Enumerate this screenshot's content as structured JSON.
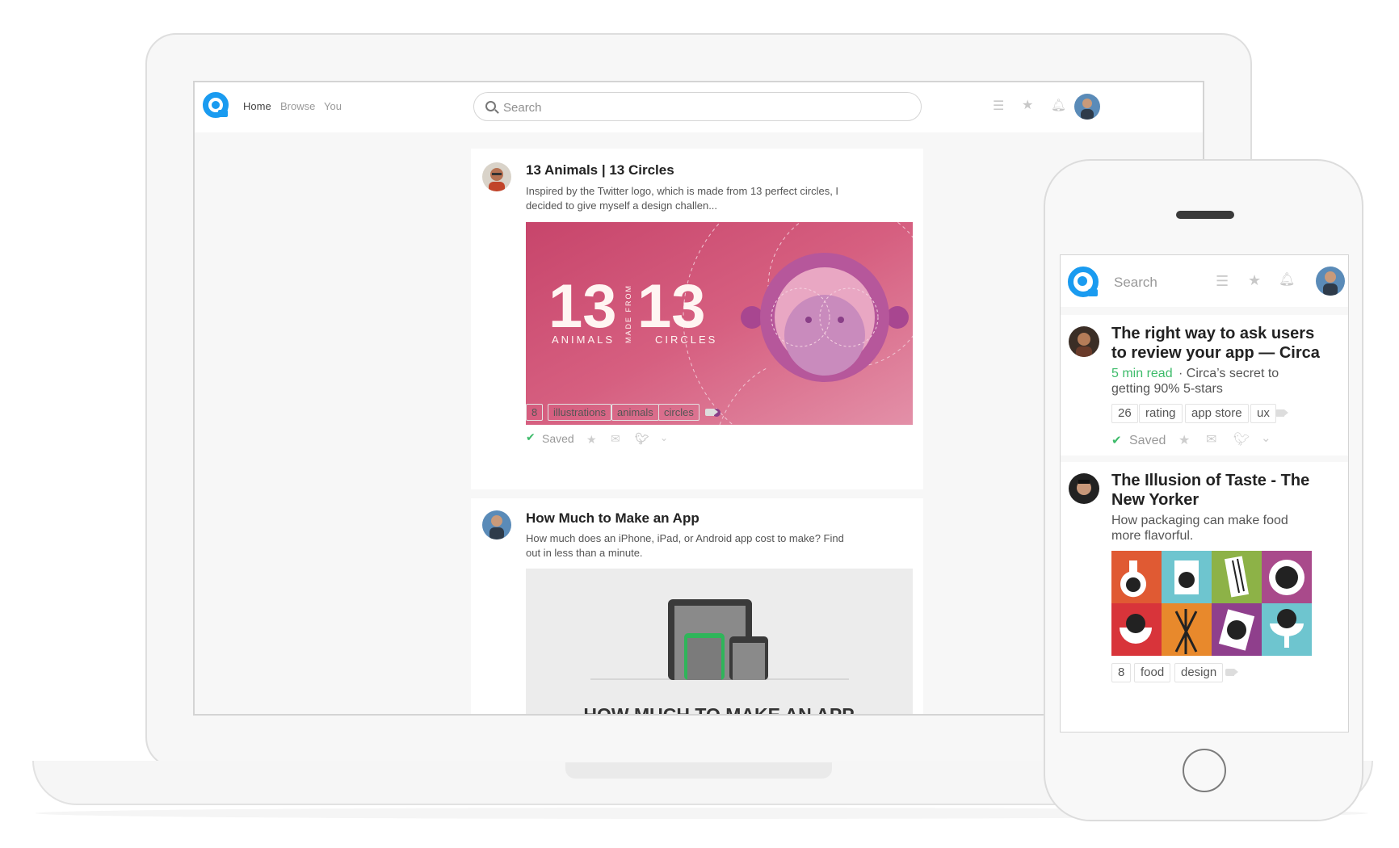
{
  "desktop": {
    "nav": {
      "home": "Home",
      "browse": "Browse",
      "you": "You"
    },
    "search": {
      "placeholder": "Search"
    },
    "articles": [
      {
        "title": "13 Animals | 13 Circles",
        "excerpt_line1": "Inspired by the Twitter logo, which is made from 13 perfect circles, I",
        "excerpt_line2": "decided to give myself a design challen...",
        "image": {
          "num_left": "13",
          "num_right": "13",
          "label_left": "ANIMALS",
          "label_mid": "MADE FROM",
          "label_right": "CIRCLES"
        },
        "count": "8",
        "tags": [
          "illustrations",
          "animals",
          "circles"
        ],
        "saved_label": "Saved"
      },
      {
        "title": "How Much to Make an App",
        "excerpt_line1": "How much does an iPhone, iPad, or Android app cost to make? Find",
        "excerpt_line2": "out in less than a minute.",
        "image": {
          "heading": "HOW MUCH TO MAKE AN APP"
        }
      }
    ]
  },
  "mobile": {
    "search": {
      "placeholder": "Search"
    },
    "articles": [
      {
        "title_line1": "The right way to ask users",
        "title_line2": "to review your app — Circa",
        "read_time": "5 min read",
        "excerpt_line1": " · Circa’s secret to",
        "excerpt_line2": "getting 90% 5-stars",
        "count": "26",
        "tags": [
          "rating",
          "app store",
          "ux"
        ],
        "saved_label": "Saved"
      },
      {
        "title_line1": "The Illusion of Taste - The",
        "title_line2": "New Yorker",
        "excerpt_line1": "How packaging can make food",
        "excerpt_line2": "more flavorful.",
        "count": "8",
        "tags": [
          "food",
          "design"
        ]
      }
    ]
  },
  "colors": {
    "brand": "#1a9bf0",
    "saved": "#3dbb6a",
    "read_time": "#3dbb6a"
  },
  "icons": [
    "search-icon",
    "list-icon",
    "star-icon",
    "bell-icon",
    "tag-icon",
    "check-icon",
    "mail-icon",
    "twitter-icon",
    "chevron-down-icon"
  ]
}
